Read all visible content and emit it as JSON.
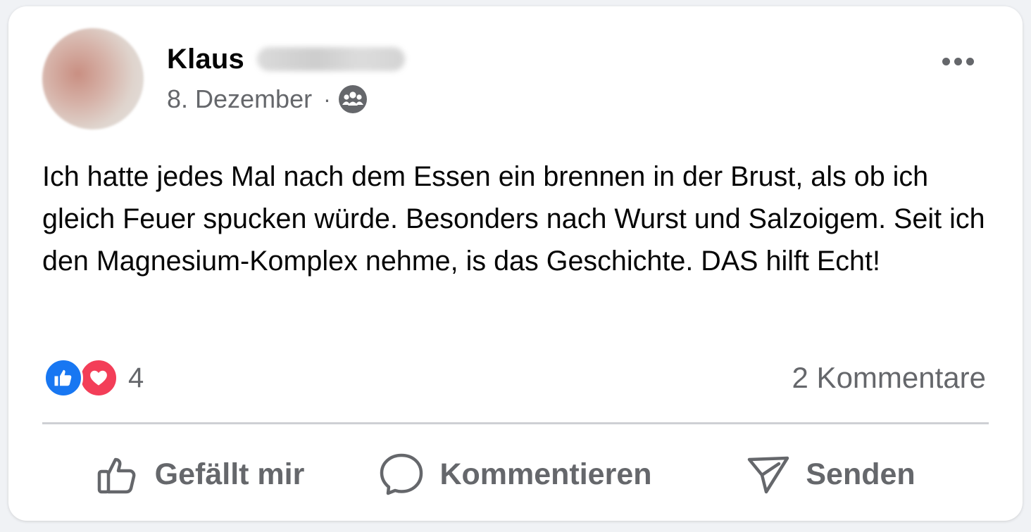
{
  "post": {
    "author_first_name": "Klaus",
    "date": "8. Dezember",
    "separator": "·",
    "audience_icon": "group-icon",
    "more_icon": "more-horizontal-icon",
    "text": "Ich hatte jedes Mal nach dem Essen ein brennen in der Brust, als ob ich gleich Feuer spucken würde. Besonders nach Wurst und Salzoigem. Seit ich den Magnesium-Komplex nehme, is das Geschichte. DAS hilft Echt!"
  },
  "stats": {
    "reactions_count": "4",
    "reaction_icons": [
      "like-reaction-icon",
      "love-reaction-icon"
    ],
    "comments": "2 Kommentare"
  },
  "actions": {
    "like_label": "Gefällt mir",
    "comment_label": "Kommentieren",
    "send_label": "Senden"
  },
  "colors": {
    "like_blue": "#1877f2",
    "love_red": "#f33e58",
    "secondary_text": "#65676b",
    "primary_text": "#050505"
  }
}
